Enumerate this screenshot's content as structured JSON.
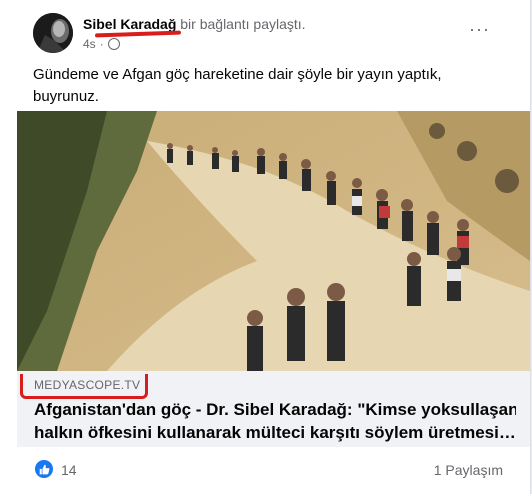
{
  "post": {
    "author": "Sibel Karadağ",
    "action": "bir bağlantı paylaştı.",
    "time": "4s",
    "text": "Gündeme ve Afgan göç hareketine dair şöyle bir yayın yaptık, buyrunuz."
  },
  "link": {
    "domain": "MEDYASCOPE.TV",
    "title_line1": "Afganistan'dan göç - Dr. Sibel Karadağ: \"Kimse yoksullaşan",
    "title_line2": "halkın öfkesini kullanarak mülteci karşıtı söylem üretmesi…"
  },
  "reactions": {
    "count": "14",
    "shares": "1 Paylaşım"
  },
  "colors": {
    "brand_blue": "#1877f2",
    "annotation_red": "#d91d1d"
  },
  "icons": [
    "avatar",
    "globe-icon",
    "more-options-icon",
    "like-icon"
  ]
}
